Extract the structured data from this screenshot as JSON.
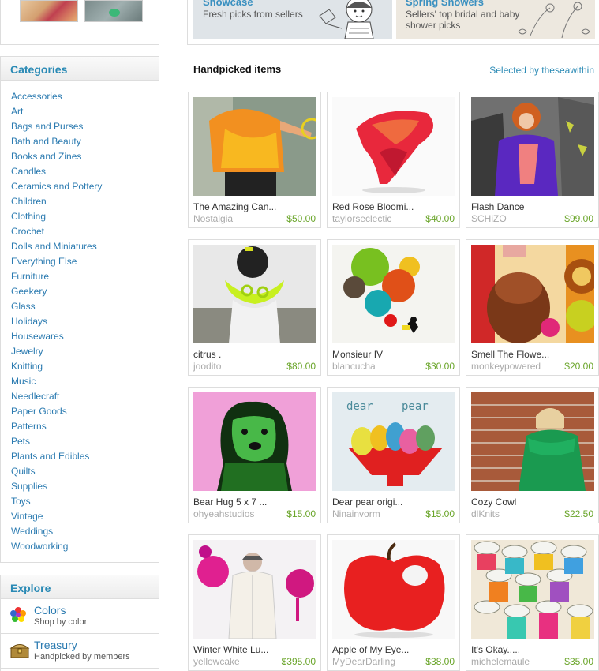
{
  "banners": [
    {
      "title": "Showcase",
      "subtitle": "Fresh picks from sellers"
    },
    {
      "title": "Spring Showers",
      "subtitle_line1": "Sellers' top bridal and baby",
      "subtitle_line2": "shower picks"
    }
  ],
  "categories": {
    "title": "Categories",
    "items": [
      "Accessories",
      "Art",
      "Bags and Purses",
      "Bath and Beauty",
      "Books and Zines",
      "Candles",
      "Ceramics and Pottery",
      "Children",
      "Clothing",
      "Crochet",
      "Dolls and Miniatures",
      "Everything Else",
      "Furniture",
      "Geekery",
      "Glass",
      "Holidays",
      "Housewares",
      "Jewelry",
      "Knitting",
      "Music",
      "Needlecraft",
      "Paper Goods",
      "Patterns",
      "Pets",
      "Plants and Edibles",
      "Quilts",
      "Supplies",
      "Toys",
      "Vintage",
      "Weddings",
      "Woodworking"
    ]
  },
  "explore": {
    "title": "Explore",
    "items": [
      {
        "label": "Colors",
        "sub": "Shop by color",
        "icon": "color-wheel-icon"
      },
      {
        "label": "Treasury",
        "sub": "Handpicked by members",
        "icon": "treasure-chest-icon"
      }
    ]
  },
  "handpicked": {
    "title": "Handpicked items",
    "selected_by": "Selected by theseawithin",
    "items": [
      {
        "title": "The Amazing Can...",
        "shop": "Nostalgia",
        "price": "$50.00"
      },
      {
        "title": "Red Rose Bloomi...",
        "shop": "taylorseclectic",
        "price": "$40.00"
      },
      {
        "title": "Flash Dance",
        "shop": "SCHiZO",
        "price": "$99.00"
      },
      {
        "title": "citrus .",
        "shop": "joodito",
        "price": "$80.00"
      },
      {
        "title": "Monsieur IV",
        "shop": "blancucha",
        "price": "$30.00"
      },
      {
        "title": "Smell The Flowe...",
        "shop": "monkeypowered",
        "price": "$20.00"
      },
      {
        "title": "Bear Hug 5 x 7 ...",
        "shop": "ohyeahstudios",
        "price": "$15.00"
      },
      {
        "title": "Dear pear origi...",
        "shop": "Ninainvorm",
        "price": "$15.00"
      },
      {
        "title": "Cozy Cowl",
        "shop": "dlKnits",
        "price": "$22.50"
      },
      {
        "title": "Winter White Lu...",
        "shop": "yellowcake",
        "price": "$395.00"
      },
      {
        "title": "Apple of My Eye...",
        "shop": "MyDearDarling",
        "price": "$38.00"
      },
      {
        "title": "It's Okay.....",
        "shop": "michelemaule",
        "price": "$35.00"
      }
    ]
  },
  "colors": {
    "link": "#2a7ab0",
    "heading": "#2a8ab5",
    "price": "#6aa52a",
    "muted": "#aaaaaa"
  }
}
